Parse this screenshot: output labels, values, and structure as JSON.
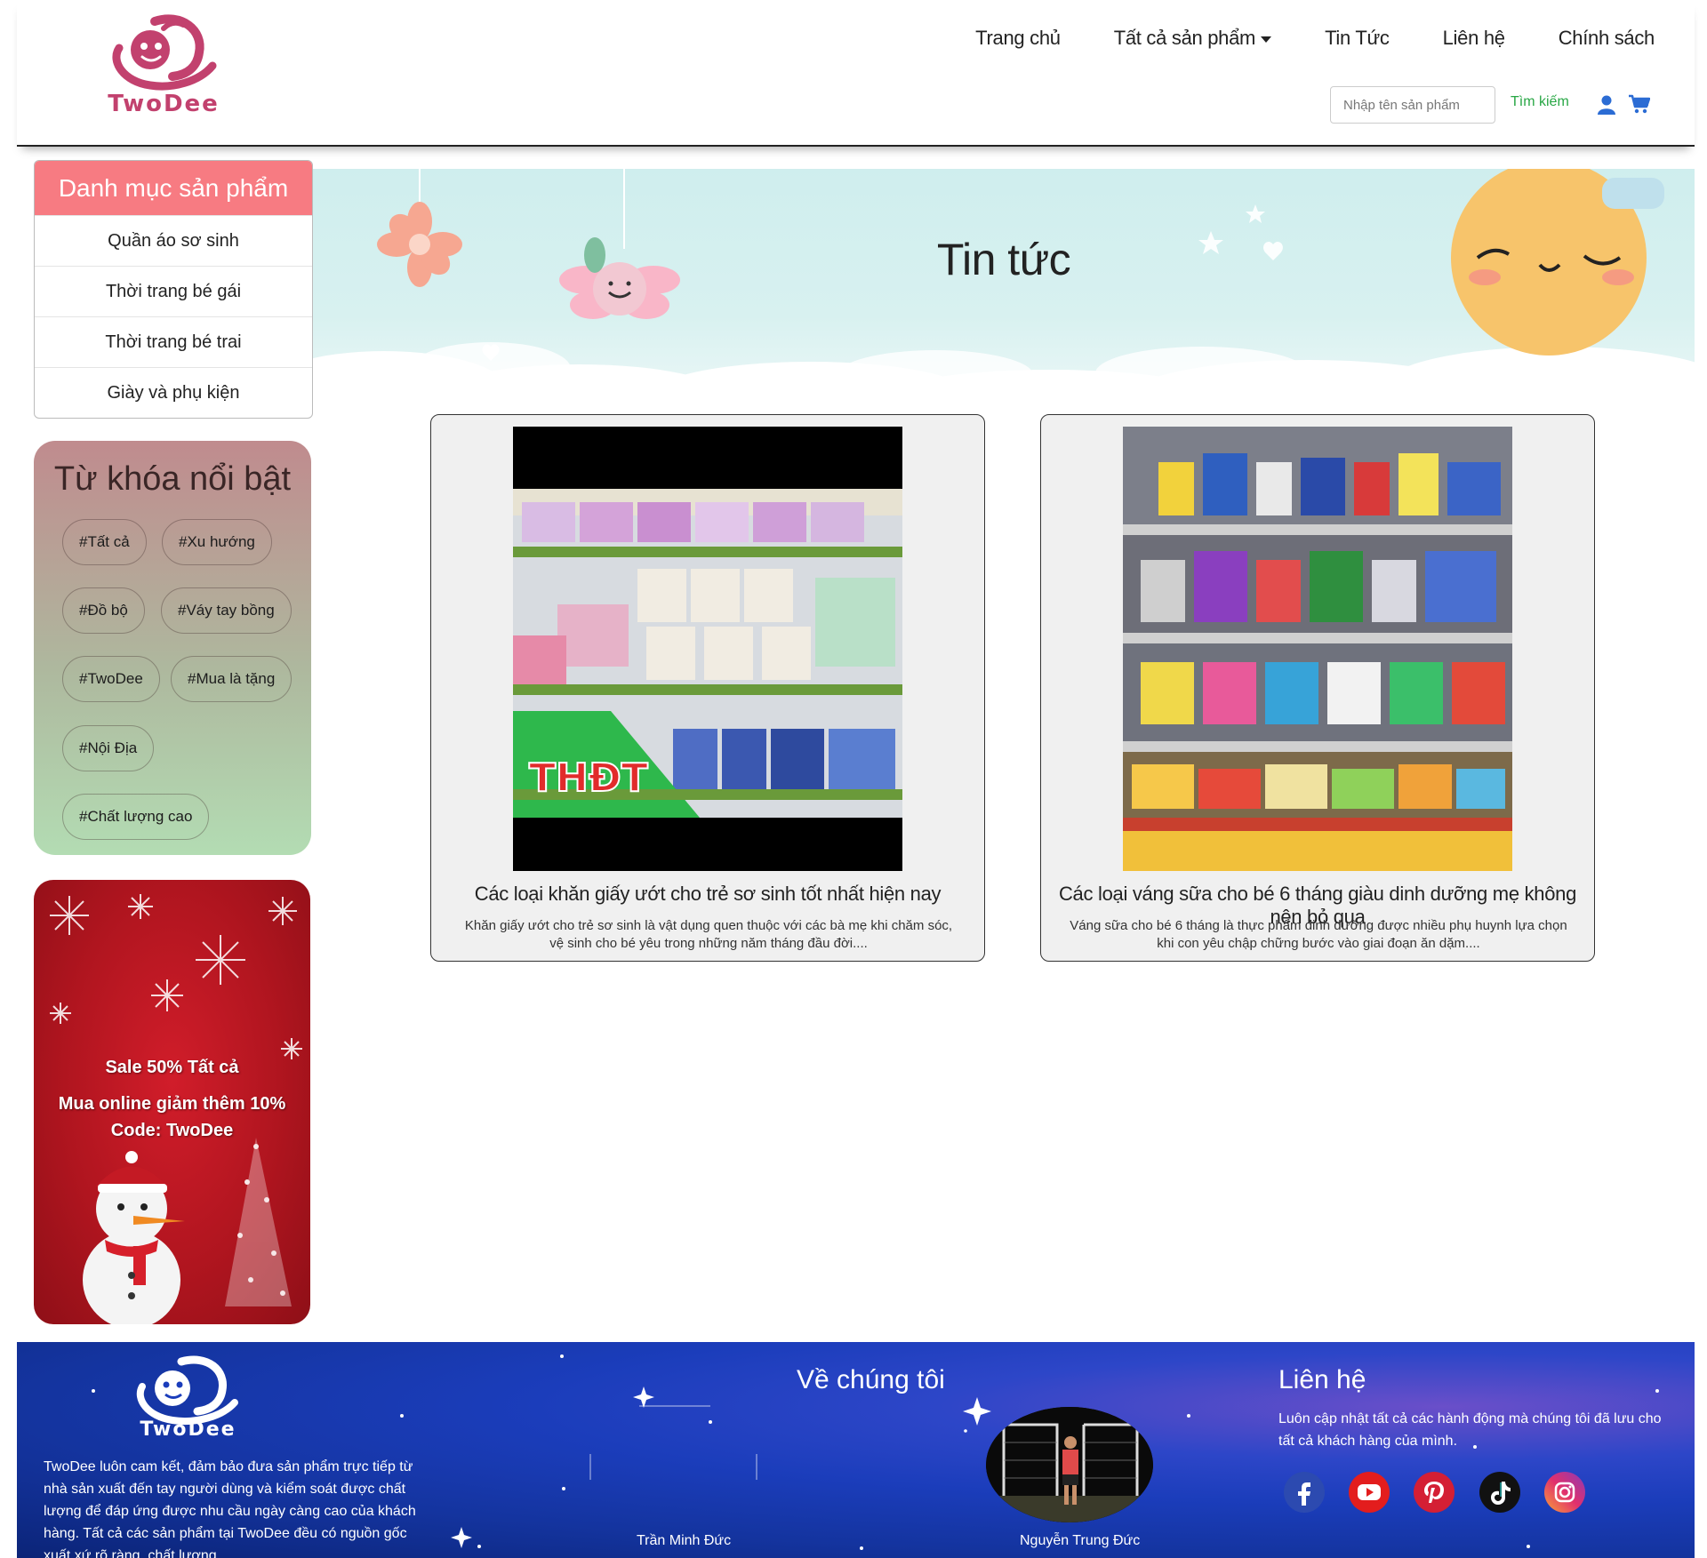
{
  "brand": {
    "name": "TwoDee",
    "primary_color": "#c2416e",
    "accent_color": "#f77b82"
  },
  "nav": {
    "items": [
      "Trang chủ",
      "Tất cả sản phẩm",
      "Tin Tức",
      "Liên hệ",
      "Chính sách"
    ]
  },
  "search": {
    "placeholder": "Nhập tên sản phẩm",
    "button_label": "Tìm kiếm"
  },
  "sidebar": {
    "category_title": "Danh mục sản phẩm",
    "categories": [
      "Quần áo sơ sinh",
      "Thời trang bé gái",
      "Thời trang bé trai",
      "Giày và phụ kiện"
    ],
    "keywords_title": "Từ khóa nổi bật",
    "keywords": [
      "#Tất cả",
      "#Xu hướng",
      "#Đồ bộ",
      "#Váy tay bồng",
      "#TwoDee",
      "#Mua là tặng",
      "#Nội Địa",
      "#Chất lượng cao"
    ],
    "promo": {
      "line1": "Sale 50% Tất cả",
      "line2": "Mua online giảm thêm 10%",
      "line3": "Code: TwoDee"
    }
  },
  "banner": {
    "title": "Tin tức"
  },
  "news": [
    {
      "title": "Các loại khăn giấy ướt cho trẻ sơ sinh tốt nhất hiện nay",
      "description": "Khăn giấy ướt cho trẻ sơ sinh là vật dụng quen thuộc với các bà mẹ khi chăm sóc, vệ sinh cho bé yêu trong những năm tháng đầu đời....",
      "image_badge": "THĐT"
    },
    {
      "title": "Các loại váng sữa cho bé 6 tháng giàu dinh dưỡng mẹ không nên bỏ qua",
      "description": "Váng sữa cho bé 6 tháng là thực phẩm dinh dưỡng được nhiều phụ huynh lựa chọn khi con yêu chập chững bước vào giai đoạn ăn dặm...."
    }
  ],
  "footer": {
    "about_text": "TwoDee luôn cam kết, đảm bảo đưa sản phẩm trực tiếp từ nhà sản xuất đến tay người dùng và kiểm soát được chất lượng để đáp ứng được nhu cầu ngày càng cao của khách hàng. Tất cả các sản phẩm tại TwoDee đều có nguồn gốc xuất xứ rõ ràng, chất lượng.",
    "about_title": "Về chúng tôi",
    "members": [
      "Trần Minh Đức",
      "Nguyễn Trung Đức"
    ],
    "contact_title": "Liên hệ",
    "contact_text": "Luôn cập nhật tất cả các hành động mà chúng tôi đã lưu cho tất cả khách hàng của mình.",
    "socials": [
      "facebook-icon",
      "youtube-icon",
      "pinterest-icon",
      "tiktok-icon",
      "instagram-icon"
    ]
  }
}
